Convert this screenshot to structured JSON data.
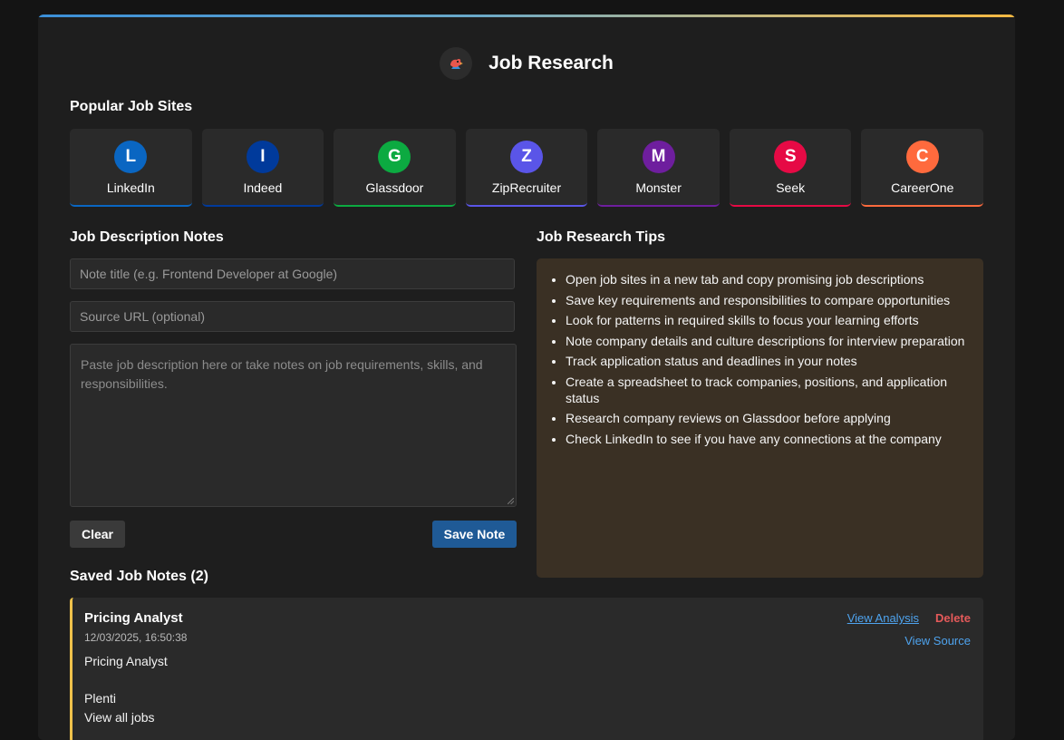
{
  "header": {
    "title": "Job Research",
    "logo_icon": "rooster-icon"
  },
  "sites_section": {
    "title": "Popular Job Sites"
  },
  "sites": [
    {
      "initial": "L",
      "name": "LinkedIn",
      "color": "#0a66c2"
    },
    {
      "initial": "I",
      "name": "Indeed",
      "color": "#003a9b"
    },
    {
      "initial": "G",
      "name": "Glassdoor",
      "color": "#0caa41"
    },
    {
      "initial": "Z",
      "name": "ZipRecruiter",
      "color": "#5a55e8"
    },
    {
      "initial": "M",
      "name": "Monster",
      "color": "#6e1e9e"
    },
    {
      "initial": "S",
      "name": "Seek",
      "color": "#e60a45"
    },
    {
      "initial": "C",
      "name": "CareerOne",
      "color": "#ff6a3d"
    }
  ],
  "notes_form": {
    "title": "Job Description Notes",
    "title_placeholder": "Note title (e.g. Frontend Developer at Google)",
    "url_placeholder": "Source URL (optional)",
    "body_placeholder": "Paste job description here or take notes on job requirements, skills, and responsibilities.",
    "clear_label": "Clear",
    "save_label": "Save Note"
  },
  "tips": {
    "title": "Job Research Tips",
    "items": [
      "Open job sites in a new tab and copy promising job descriptions",
      "Save key requirements and responsibilities to compare opportunities",
      "Look for patterns in required skills to focus your learning efforts",
      "Note company details and culture descriptions for interview preparation",
      "Track application status and deadlines in your notes",
      "Create a spreadsheet to track companies, positions, and application status",
      "Research company reviews on Glassdoor before applying",
      "Check LinkedIn to see if you have any connections at the company"
    ]
  },
  "saved": {
    "title": "Saved Job Notes (2)",
    "notes": [
      {
        "title": "Pricing Analyst",
        "date": "12/03/2025, 16:50:38",
        "view_analysis_label": "View Analysis",
        "delete_label": "Delete",
        "view_source_label": "View Source",
        "body_lines": [
          "Pricing Analyst",
          "",
          "Plenti",
          "View all jobs"
        ]
      }
    ]
  }
}
